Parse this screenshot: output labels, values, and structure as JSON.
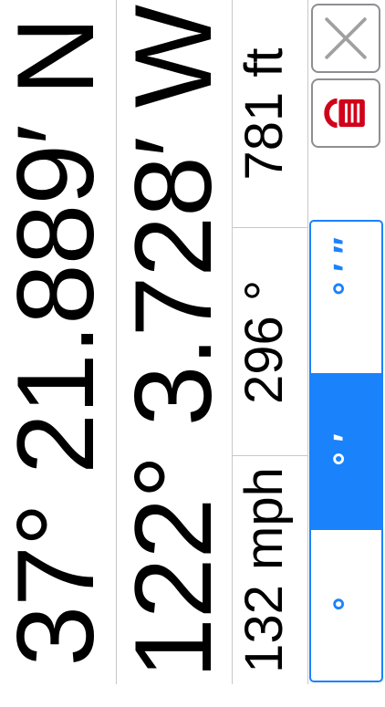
{
  "coordinates": {
    "latitude": "37° 21.889′ N",
    "longitude": "122° 3.728′ W"
  },
  "stats": {
    "altitude": "781 ft",
    "heading": "296 °",
    "speed": "132 mph"
  },
  "buttons": {
    "close_icon": "close-icon",
    "lock_icon": "padlock-icon",
    "lock_color": "#d0021b"
  },
  "format_selector": {
    "options": [
      "° ′ ″",
      "° ′",
      "°"
    ],
    "selected": "° ′",
    "accent": "#1a82fb"
  }
}
